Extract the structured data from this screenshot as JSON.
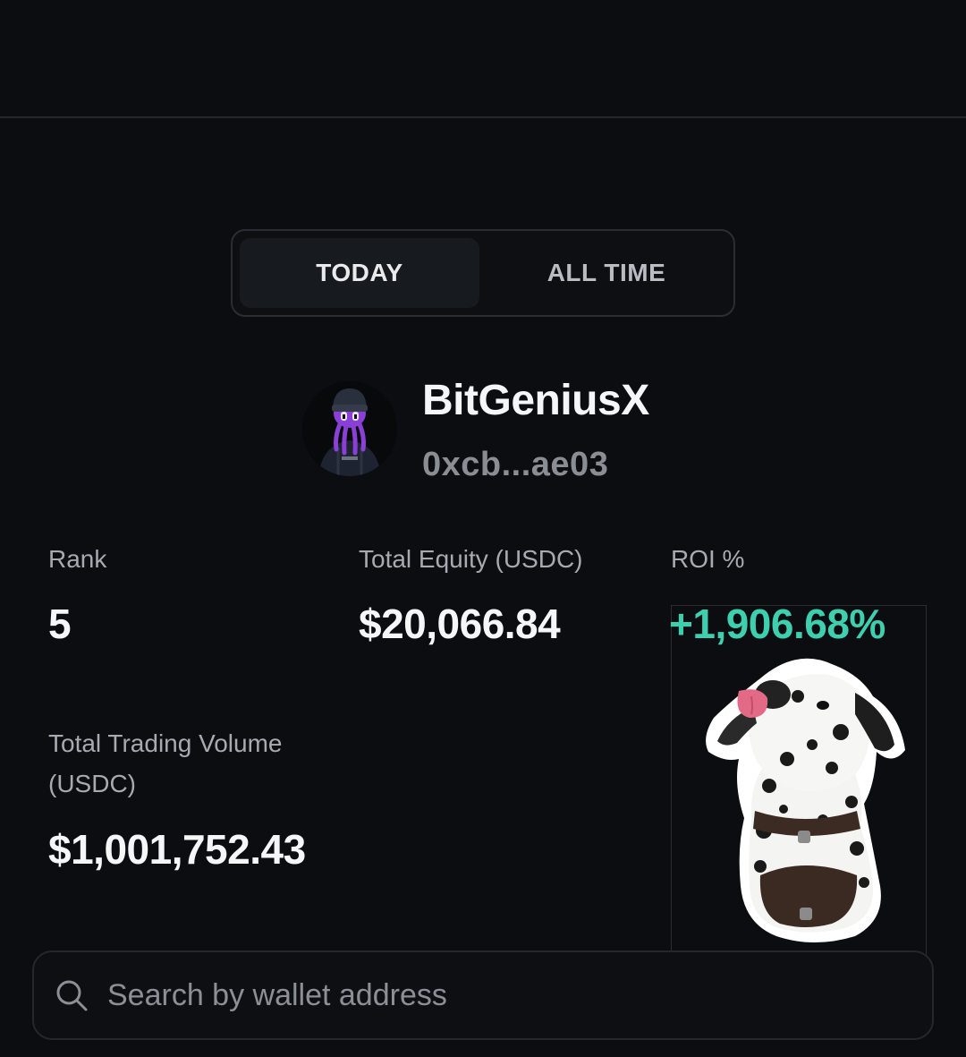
{
  "tabs": {
    "today": "TODAY",
    "all_time": "ALL TIME",
    "selected": "TODAY"
  },
  "profile": {
    "username": "BitGeniusX",
    "wallet": "0xcb...ae03"
  },
  "stats": {
    "rank": {
      "label": "Rank",
      "value": "5"
    },
    "equity": {
      "label": "Total Equity (USDC)",
      "value": "$20,066.84"
    },
    "roi": {
      "label": "ROI %",
      "value": "+1,906.68%"
    },
    "volume": {
      "label": "Total Trading Volume (USDC)",
      "value": "$1,001,752.43"
    }
  },
  "search": {
    "placeholder": "Search by wallet address",
    "value": ""
  },
  "colors": {
    "background": "#0c0d11",
    "positive": "#3ecfae",
    "avatar_accent": "#8a3fd6"
  },
  "icons": {
    "search": "search-icon"
  }
}
